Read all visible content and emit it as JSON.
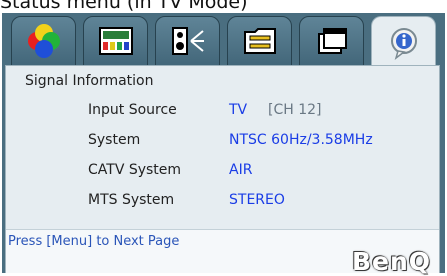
{
  "caption": "Status menu (in TV Mode)",
  "tabs": [
    {
      "icon": "color-circles-icon",
      "active": false
    },
    {
      "icon": "picture-settings-icon",
      "active": false
    },
    {
      "icon": "audio-speaker-icon",
      "active": false
    },
    {
      "icon": "setup-folder-icon",
      "active": false
    },
    {
      "icon": "display-window-icon",
      "active": false
    },
    {
      "icon": "info-icon",
      "active": true
    }
  ],
  "section_title": "Signal Information",
  "rows": [
    {
      "label": "Input Source",
      "value": "TV",
      "extra": "[CH 12]"
    },
    {
      "label": "System",
      "value": "NTSC 60Hz/3.58MHz"
    },
    {
      "label": "CATV System",
      "value": "AIR"
    },
    {
      "label": "MTS System",
      "value": "STEREO"
    }
  ],
  "hint": "Press [Menu] to Next Page",
  "logo": "BenQ",
  "colors": {
    "frame": "#4a6e80",
    "panel": "#e6edf1",
    "value_text": "#1a3de6",
    "hint_text": "#2a55b8"
  }
}
